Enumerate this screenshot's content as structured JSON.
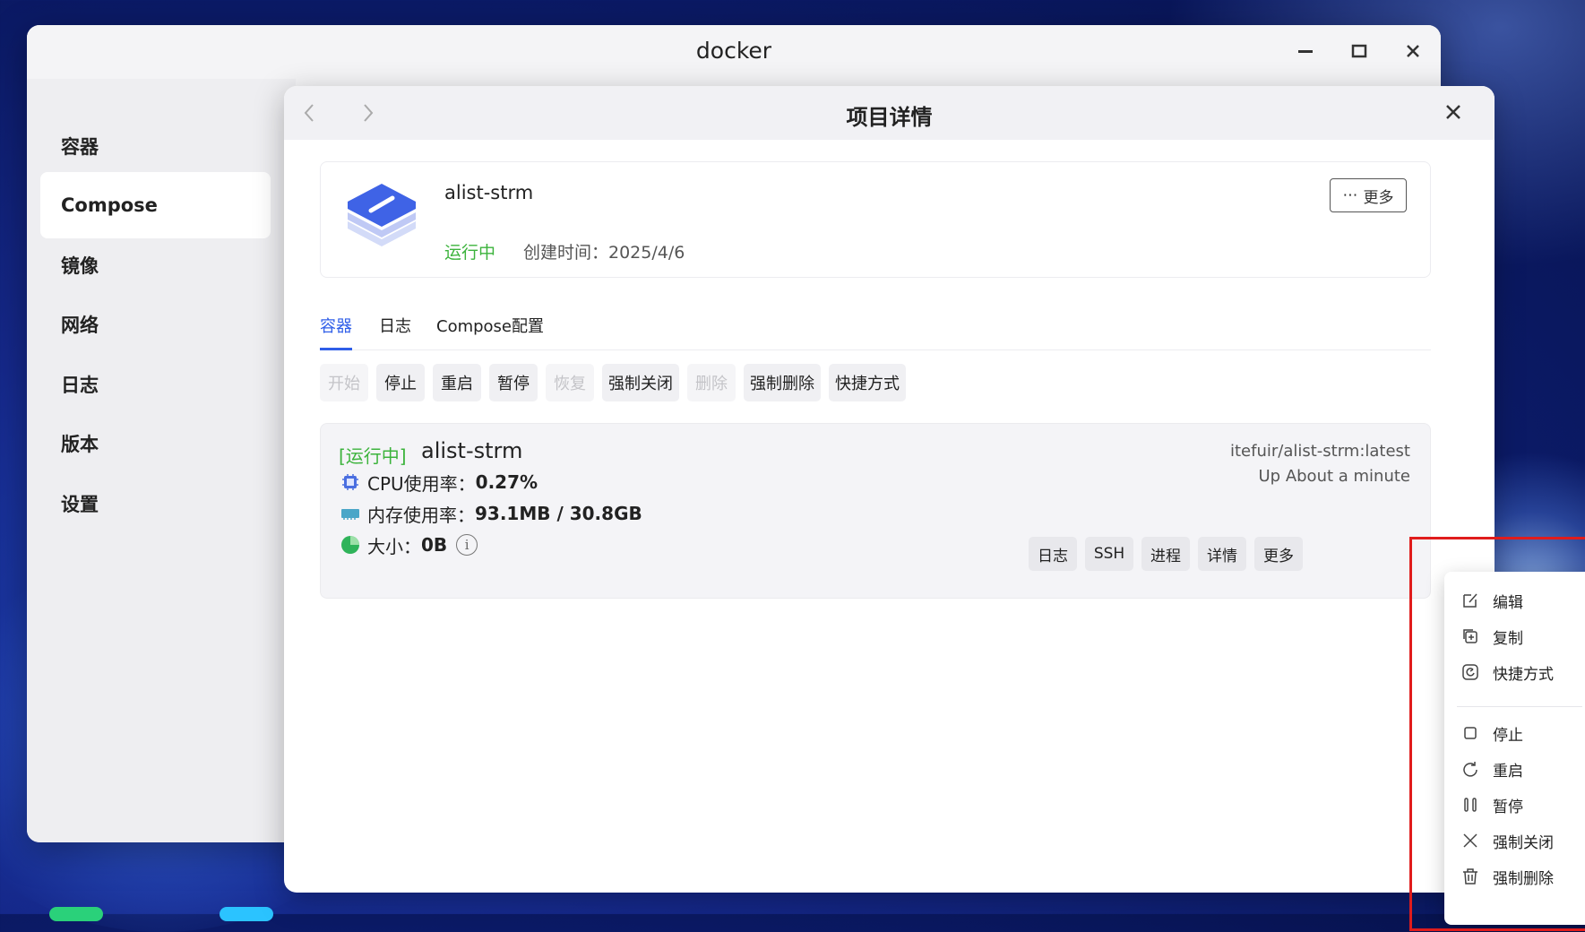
{
  "window": {
    "title": "docker"
  },
  "sidebar": {
    "items": [
      {
        "label": "容器"
      },
      {
        "label": "Compose"
      },
      {
        "label": "镜像"
      },
      {
        "label": "网络"
      },
      {
        "label": "日志"
      },
      {
        "label": "版本"
      },
      {
        "label": "设置"
      }
    ],
    "active": "Compose"
  },
  "detail": {
    "title": "项目详情",
    "project": {
      "name": "alist-strm",
      "status": "运行中",
      "created": "创建时间：2025/4/6",
      "more_label": "更多"
    },
    "tabs": [
      {
        "label": "容器"
      },
      {
        "label": "日志"
      },
      {
        "label": "Compose配置"
      }
    ],
    "actions": [
      {
        "label": "开始",
        "enabled": false
      },
      {
        "label": "停止",
        "enabled": true
      },
      {
        "label": "重启",
        "enabled": true
      },
      {
        "label": "暂停",
        "enabled": true
      },
      {
        "label": "恢复",
        "enabled": false
      },
      {
        "label": "强制关闭",
        "enabled": true
      },
      {
        "label": "删除",
        "enabled": false
      },
      {
        "label": "强制删除",
        "enabled": true
      },
      {
        "label": "快捷方式",
        "enabled": true
      }
    ],
    "container": {
      "status": "[运行中]",
      "name": "alist-strm",
      "image": "itefuir/alist-strm:latest",
      "uptime": "Up About a minute",
      "cpu_label": "CPU使用率：",
      "cpu_value": "0.27%",
      "mem_label": "内存使用率：",
      "mem_value": "93.1MB / 30.8GB",
      "size_label": "大小：",
      "size_value": "0B",
      "buttons": [
        {
          "label": "日志"
        },
        {
          "label": "SSH"
        },
        {
          "label": "进程"
        },
        {
          "label": "详情"
        },
        {
          "label": "更多"
        }
      ]
    }
  },
  "menu": {
    "items": [
      {
        "label": "编辑",
        "icon": "edit-icon"
      },
      {
        "label": "复制",
        "icon": "copy-icon"
      },
      {
        "label": "快捷方式",
        "icon": "shortcut-icon"
      },
      {
        "label": "停止",
        "icon": "stop-icon"
      },
      {
        "label": "重启",
        "icon": "restart-icon"
      },
      {
        "label": "暂停",
        "icon": "pause-icon"
      },
      {
        "label": "强制关闭",
        "icon": "close-icon"
      },
      {
        "label": "强制删除",
        "icon": "trash-icon"
      }
    ]
  },
  "colors": {
    "accent": "#2f5ee8",
    "running": "#3cb33c",
    "highlight": "#e01c1c"
  }
}
